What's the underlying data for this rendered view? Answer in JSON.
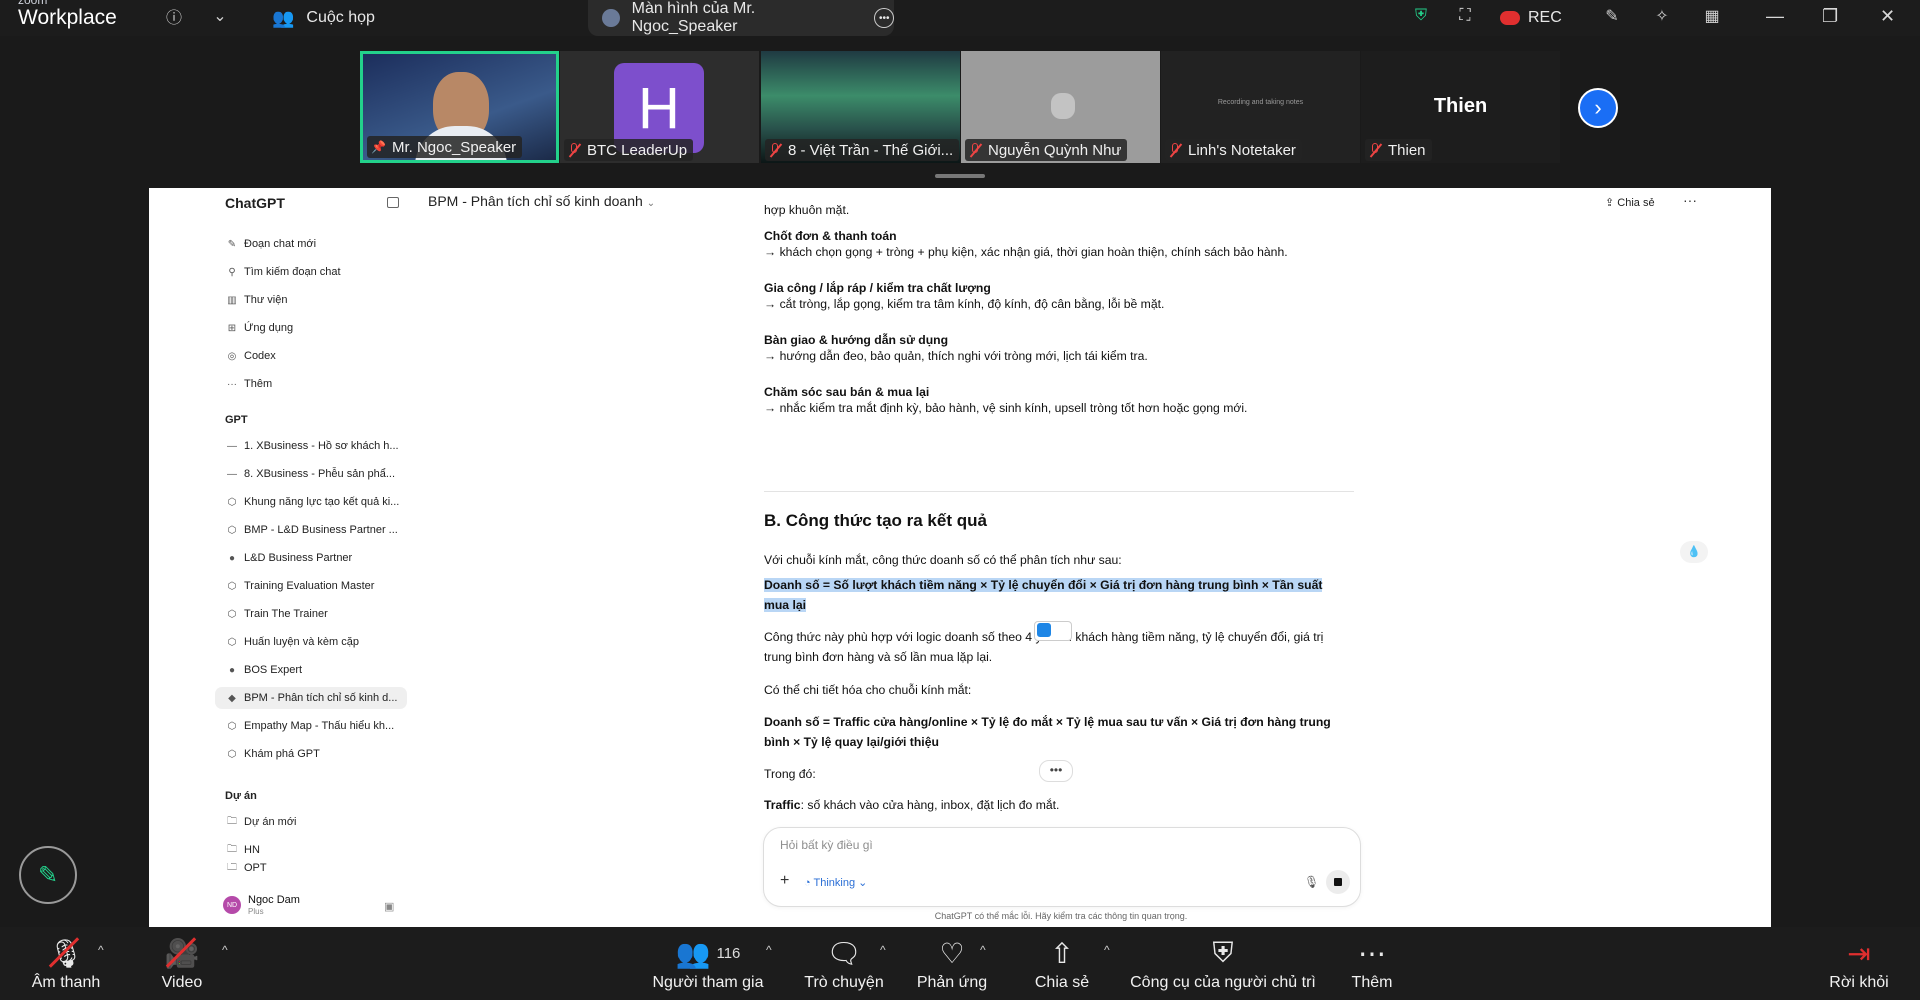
{
  "app": {
    "logo_top": "zoom",
    "logo_bottom": "Workplace"
  },
  "topbar": {
    "meeting_tab": "Cuộc họp",
    "share_tab": "Màn hình của Mr. Ngoc_Speaker",
    "rec": "REC"
  },
  "participants": [
    {
      "name": "Mr. Ngoc_Speaker"
    },
    {
      "name": "BTC LeaderUp",
      "initial": "H"
    },
    {
      "name": "8 - Việt Trần - Thế Giới..."
    },
    {
      "name": "Nguyễn Quỳnh Như"
    },
    {
      "name": "Linh's Notetaker",
      "note": "Recording and taking notes"
    },
    {
      "name": "Thien",
      "big": "Thien"
    }
  ],
  "chatgpt": {
    "brand": "ChatGPT",
    "chat_title": "BPM - Phân tích chỉ số kinh doanh",
    "share": "Chia sẻ",
    "nav": [
      "Đoạn chat mới",
      "Tìm kiếm đoạn chat",
      "Thư viện",
      "Ứng dụng",
      "Codex",
      "Thêm"
    ],
    "gpt_header": "GPT",
    "gpts": [
      "1. XBusiness - Hồ sơ khách h...",
      "8. XBusiness - Phễu sản phẩ...",
      "Khung năng lực tạo kết quả ki...",
      "BMP - L&D Business Partner ...",
      "L&D Business Partner",
      "Training Evaluation Master",
      "Train The Trainer",
      "Huấn luyện và kèm cặp",
      "BOS Expert",
      "BPM - Phân tích chỉ số kinh d...",
      "Empathy Map - Thấu hiểu kh...",
      "Khám phá GPT"
    ],
    "project_header": "Dự án",
    "projects": [
      "Dự án mới",
      "HN",
      "OPT"
    ],
    "user": {
      "name": "Ngoc Dam",
      "plan": "Plus",
      "initials": "ND"
    },
    "content": {
      "line0": "hợp khuôn mặt.",
      "s1_title": "Chốt đơn & thanh toán",
      "s1_text": "→ khách chọn gọng + tròng + phụ kiện, xác nhận giá, thời gian hoàn thiện, chính sách bảo hành.",
      "s2_title": "Gia công / lắp ráp / kiểm tra chất lượng",
      "s2_text": "→ cắt tròng, lắp gọng, kiểm tra tâm kính, độ kính, độ cân bằng, lỗi bề mặt.",
      "s3_title": "Bàn giao & hướng dẫn sử dụng",
      "s3_text": "→ hướng dẫn đeo, bảo quản, thích nghi với tròng mới, lịch tái kiểm tra.",
      "s4_title": "Chăm sóc sau bán & mua lại",
      "s4_text": "→ nhắc kiểm tra mắt định kỳ, bảo hành, vệ sinh kính, upsell tròng tốt hơn hoặc gọng mới.",
      "heading_b": "B. Công thức tạo ra kết quả",
      "intro": "Với chuỗi kính mắt, công thức doanh số có thể phân tích như sau:",
      "formula1": "Doanh số = Số lượt khách tiềm năng × Tỷ lệ chuyển đổi × Giá trị đơn hàng trung bình × Tần suất mua lại",
      "explain": "Công thức này phù hợp với logic doanh số theo 4 yếu tố: khách hàng tiềm năng, tỷ lệ chuyển đổi, giá trị trung bình đơn hàng và số lần mua lặp lại.",
      "detail_intro": "Có thể chi tiết hóa cho chuỗi kính mắt:",
      "formula2": "Doanh số = Traffic cửa hàng/online × Tỷ lệ đo mắt × Tỷ lệ mua sau tư vấn × Giá trị đơn hàng trung bình × Tỷ lệ quay lại/giới thiệu",
      "where": "Trong đó:",
      "traffic_label": "Traffic",
      "traffic_text": ": số khách vào cửa hàng, inbox, đặt lịch đo mắt."
    },
    "composer": {
      "placeholder": "Hỏi bất kỳ điều gì",
      "mode": "Thinking"
    },
    "disclaimer": "ChatGPT có thể mắc lỗi. Hãy kiểm tra các thông tin quan trọng."
  },
  "toolbar": {
    "audio": "Âm thanh",
    "video": "Video",
    "participants": "Người tham gia",
    "participants_count": "116",
    "chat": "Trò chuyện",
    "reactions": "Phản ứng",
    "share": "Chia sẻ",
    "host_tools": "Công cụ của người chủ trì",
    "more": "Thêm",
    "leave": "Rời khỏi"
  },
  "colors": {
    "active_speaker": "#23d18b",
    "leave": "#e02f2f",
    "next": "#1a6ef5",
    "highlight": "#b9d6f5"
  }
}
